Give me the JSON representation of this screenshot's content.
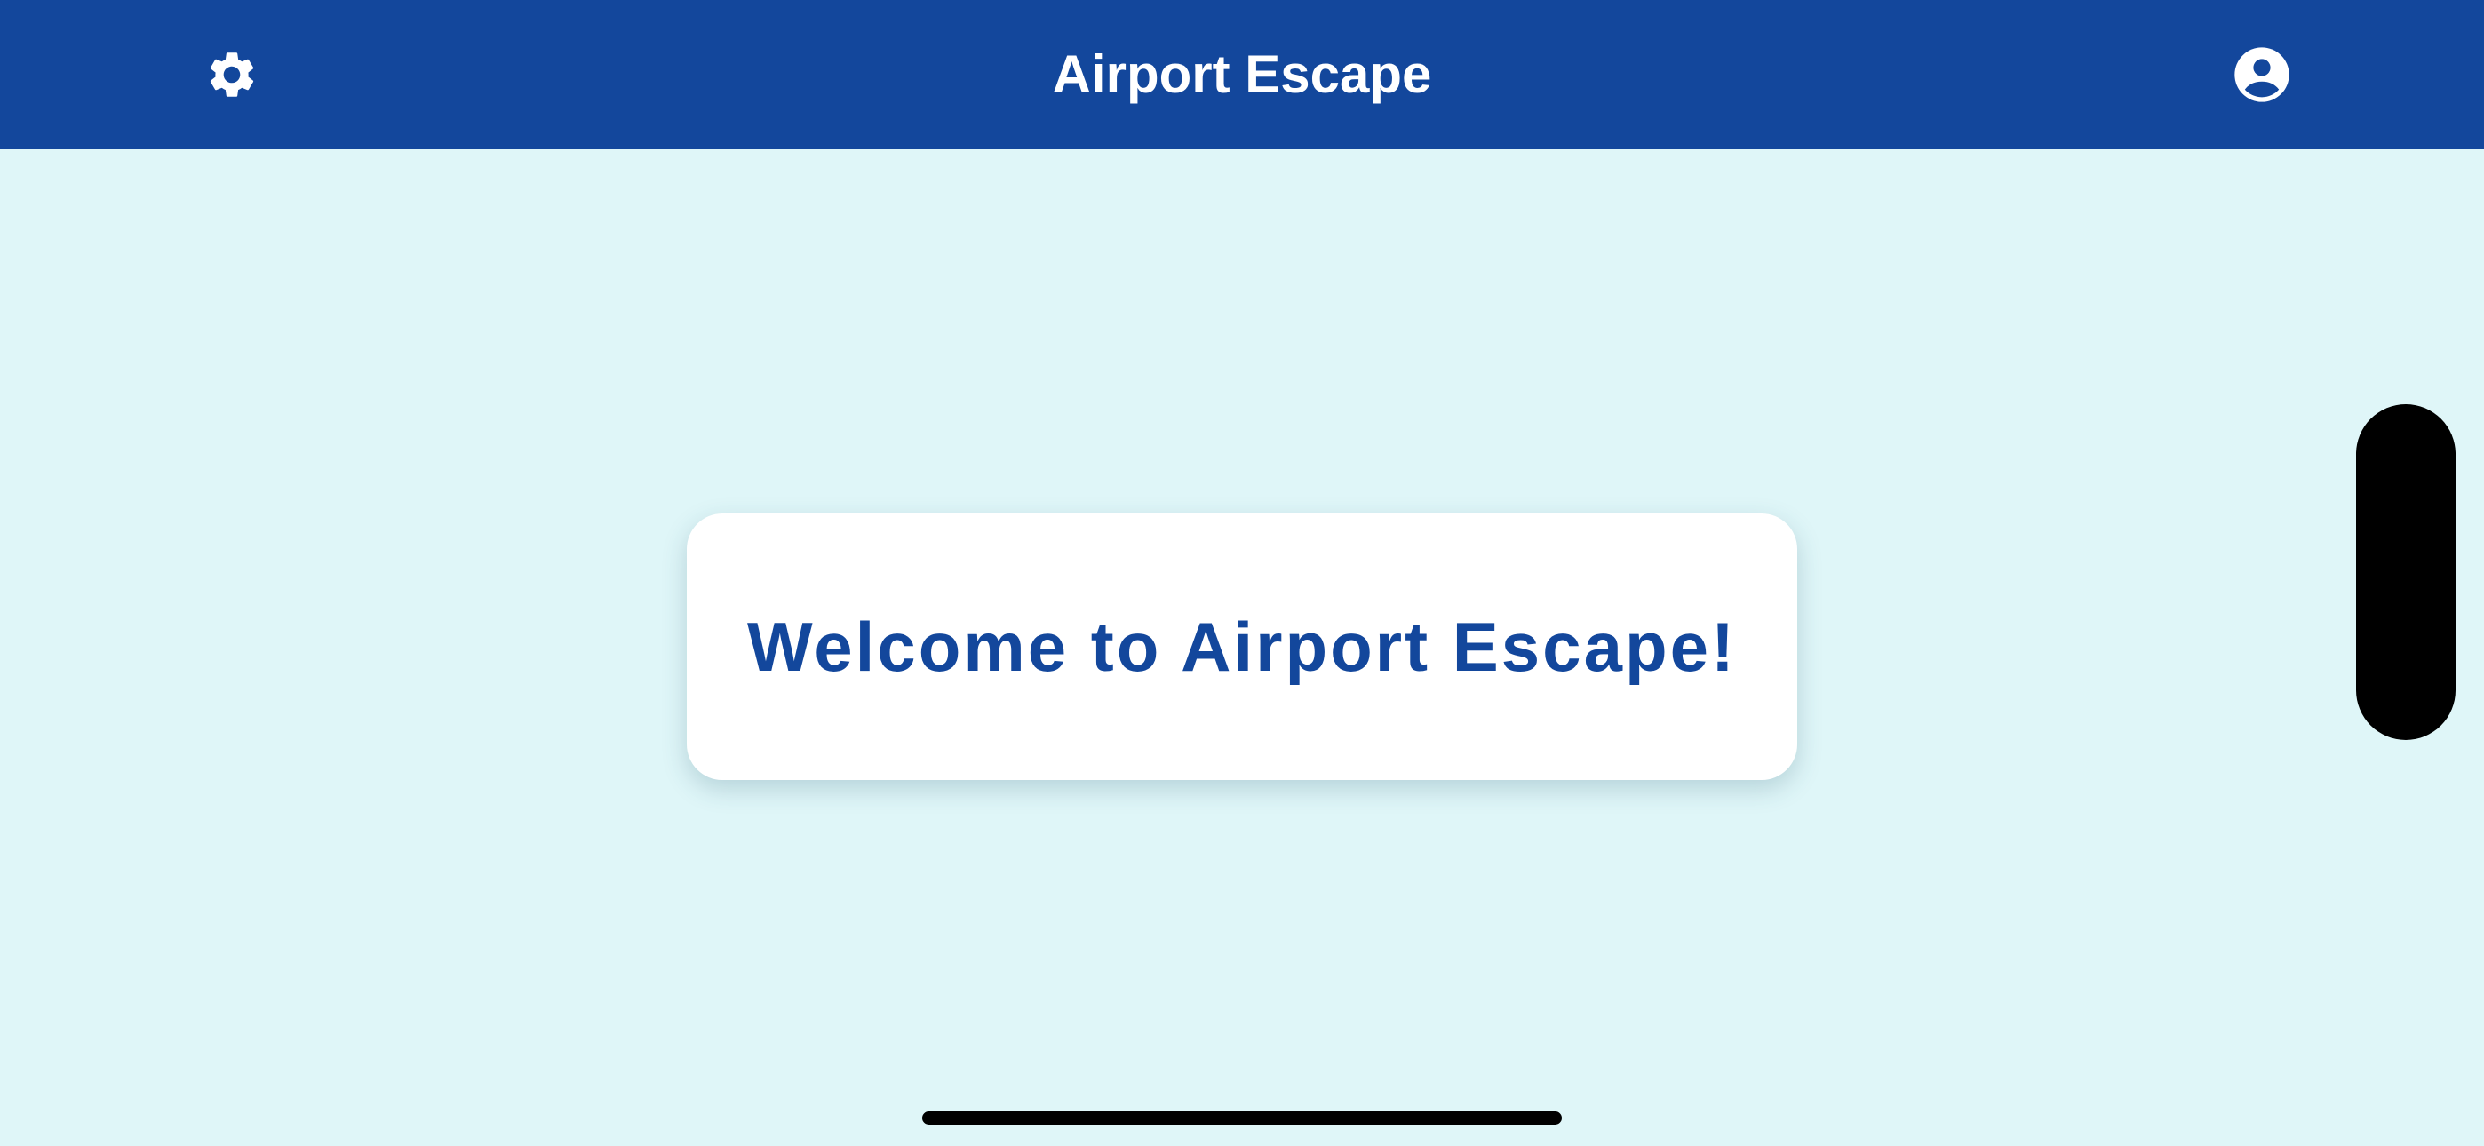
{
  "app": {
    "title": "Airport Escape"
  },
  "header": {
    "settings_icon": "gear-icon",
    "profile_icon": "user-circle-icon"
  },
  "main": {
    "welcome_message": "Welcome to Airport Escape!"
  },
  "colors": {
    "header_background": "#13479c",
    "page_background": "#dff6f8",
    "card_background": "#ffffff",
    "accent_text": "#13479c"
  }
}
